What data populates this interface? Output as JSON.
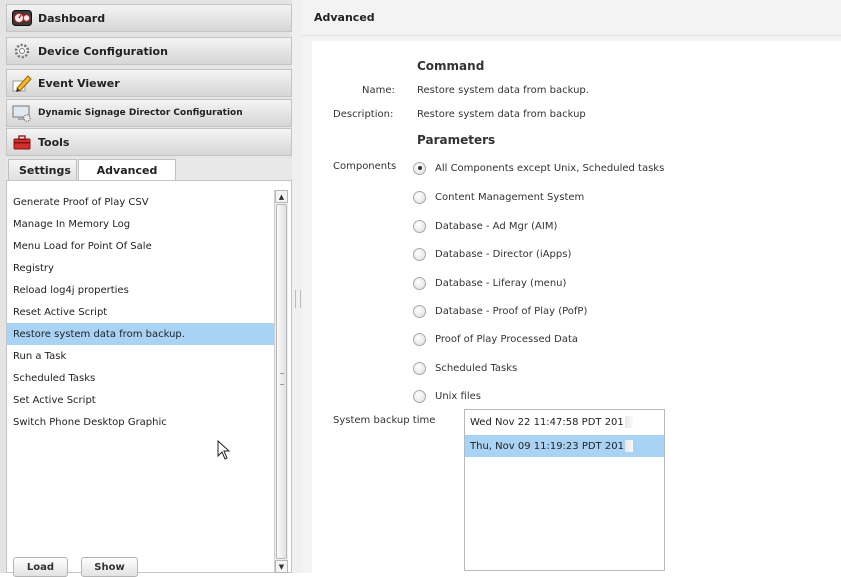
{
  "accordion": [
    {
      "label": "Dashboard",
      "icon": "dashboard-icon"
    },
    {
      "label": "Device Configuration",
      "icon": "gear-icon"
    },
    {
      "label": "Event Viewer",
      "icon": "pencil-icon"
    },
    {
      "label": "Dynamic Signage Director Configuration",
      "icon": "monitor-icon"
    },
    {
      "label": "Tools",
      "icon": "toolbox-icon"
    }
  ],
  "tabs": {
    "settings": "Settings",
    "advanced": "Advanced",
    "active": "Advanced"
  },
  "advanced_list": {
    "items": [
      "Generate Proof of Play CSV",
      "Manage In Memory Log",
      "Menu Load for Point Of Sale",
      "Registry",
      "Reload log4j properties",
      "Reset Active Script",
      "Restore system data from backup.",
      "Run a Task",
      "Scheduled Tasks",
      "Set Active Script",
      "Switch Phone Desktop Graphic"
    ],
    "selected": "Restore system data from backup."
  },
  "buttons": {
    "load": "Load",
    "show": "Show"
  },
  "right_panel": {
    "header": "Advanced",
    "command_heading": "Command",
    "name_label": "Name:",
    "name_value": "Restore system data from backup.",
    "description_label": "Description:",
    "description_value": "Restore system data from backup",
    "parameters_heading": "Parameters",
    "components_label": "Components",
    "components": [
      "All Components except Unix, Scheduled tasks",
      "Content Management System",
      "Database - Ad Mgr (AIM)",
      "Database - Director (iApps)",
      "Database - Liferay (menu)",
      "Database - Proof of Play (PofP)",
      "Proof of Play Processed Data",
      "Scheduled Tasks",
      "Unix files"
    ],
    "components_selected": "All Components except Unix, Scheduled tasks",
    "backup_time_label": "System backup time",
    "backup_times": [
      "Wed Nov 22 11:47:58 PDT 201",
      "Thu, Nov 09 11:19:23 PDT 201"
    ],
    "backup_selected": "Thu, Nov 09 11:19:23 PDT 201"
  },
  "colors": {
    "selection": "#a9d3f5",
    "panel_bg": "#f3f3f3",
    "accordion_bg": "#dcdcdc"
  }
}
